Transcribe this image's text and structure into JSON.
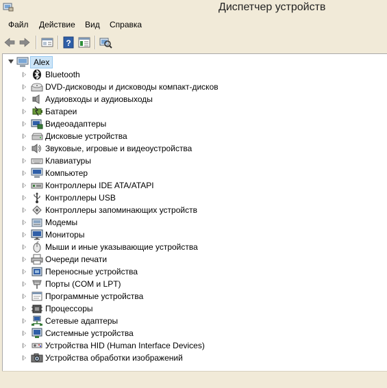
{
  "window": {
    "title": "Диспетчер устройств",
    "background": "#f1ead8"
  },
  "menu": [
    "Файл",
    "Действие",
    "Вид",
    "Справка"
  ],
  "toolbar": {
    "buttons": [
      "back-icon",
      "forward-icon",
      "properties-panel-icon",
      "help-icon",
      "device-list-icon",
      "scan-hardware-icon"
    ]
  },
  "tree": {
    "root": {
      "label": "Alex",
      "icon": "computer-icon",
      "expanded": true
    },
    "nodes": [
      {
        "label": "Bluetooth",
        "icon": "bluetooth-icon"
      },
      {
        "label": "DVD-дисководы и дисководы компакт-дисков",
        "icon": "dvd-drive-icon"
      },
      {
        "label": "Аудиовходы и аудиовыходы",
        "icon": "speaker-icon"
      },
      {
        "label": "Батареи",
        "icon": "battery-icon"
      },
      {
        "label": "Видеоадаптеры",
        "icon": "display-adapter-icon"
      },
      {
        "label": "Дисковые устройства",
        "icon": "disk-drive-icon"
      },
      {
        "label": "Звуковые, игровые и видеоустройства",
        "icon": "sound-device-icon"
      },
      {
        "label": "Клавиатуры",
        "icon": "keyboard-icon"
      },
      {
        "label": "Компьютер",
        "icon": "computer-icon"
      },
      {
        "label": "Контроллеры IDE ATA/ATAPI",
        "icon": "ide-controller-icon"
      },
      {
        "label": "Контроллеры USB",
        "icon": "usb-icon"
      },
      {
        "label": "Контроллеры запоминающих устройств",
        "icon": "storage-controller-icon"
      },
      {
        "label": "Модемы",
        "icon": "modem-icon"
      },
      {
        "label": "Мониторы",
        "icon": "monitor-icon"
      },
      {
        "label": "Мыши и иные указывающие устройства",
        "icon": "mouse-icon"
      },
      {
        "label": "Очереди печати",
        "icon": "printer-icon"
      },
      {
        "label": "Переносные устройства",
        "icon": "portable-device-icon"
      },
      {
        "label": "Порты (COM и LPT)",
        "icon": "port-icon"
      },
      {
        "label": "Программные устройства",
        "icon": "software-device-icon"
      },
      {
        "label": "Процессоры",
        "icon": "processor-icon"
      },
      {
        "label": "Сетевые адаптеры",
        "icon": "network-adapter-icon"
      },
      {
        "label": "Системные устройства",
        "icon": "system-device-icon"
      },
      {
        "label": "Устройства HID (Human Interface Devices)",
        "icon": "hid-icon"
      },
      {
        "label": "Устройства обработки изображений",
        "icon": "imaging-device-icon"
      }
    ]
  }
}
